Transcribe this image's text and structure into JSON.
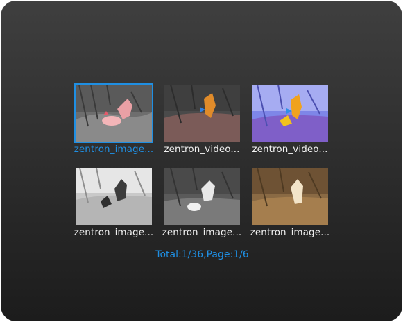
{
  "gallery": {
    "items": [
      {
        "label": "zentron_image...",
        "palette": "red-hot",
        "selected": true
      },
      {
        "label": "zentron_video...",
        "palette": "fusion-dark",
        "selected": false
      },
      {
        "label": "zentron_video...",
        "palette": "rainbow",
        "selected": false
      },
      {
        "label": "zentron_image...",
        "palette": "white-hot",
        "selected": false
      },
      {
        "label": "zentron_image...",
        "palette": "white-hot-dark",
        "selected": false
      },
      {
        "label": "zentron_image...",
        "palette": "sepia",
        "selected": false
      }
    ],
    "status": "Total:1/36,Page:1/6"
  },
  "colors": {
    "accent": "#1f8fe3",
    "label_text": "#f1f1f1"
  }
}
